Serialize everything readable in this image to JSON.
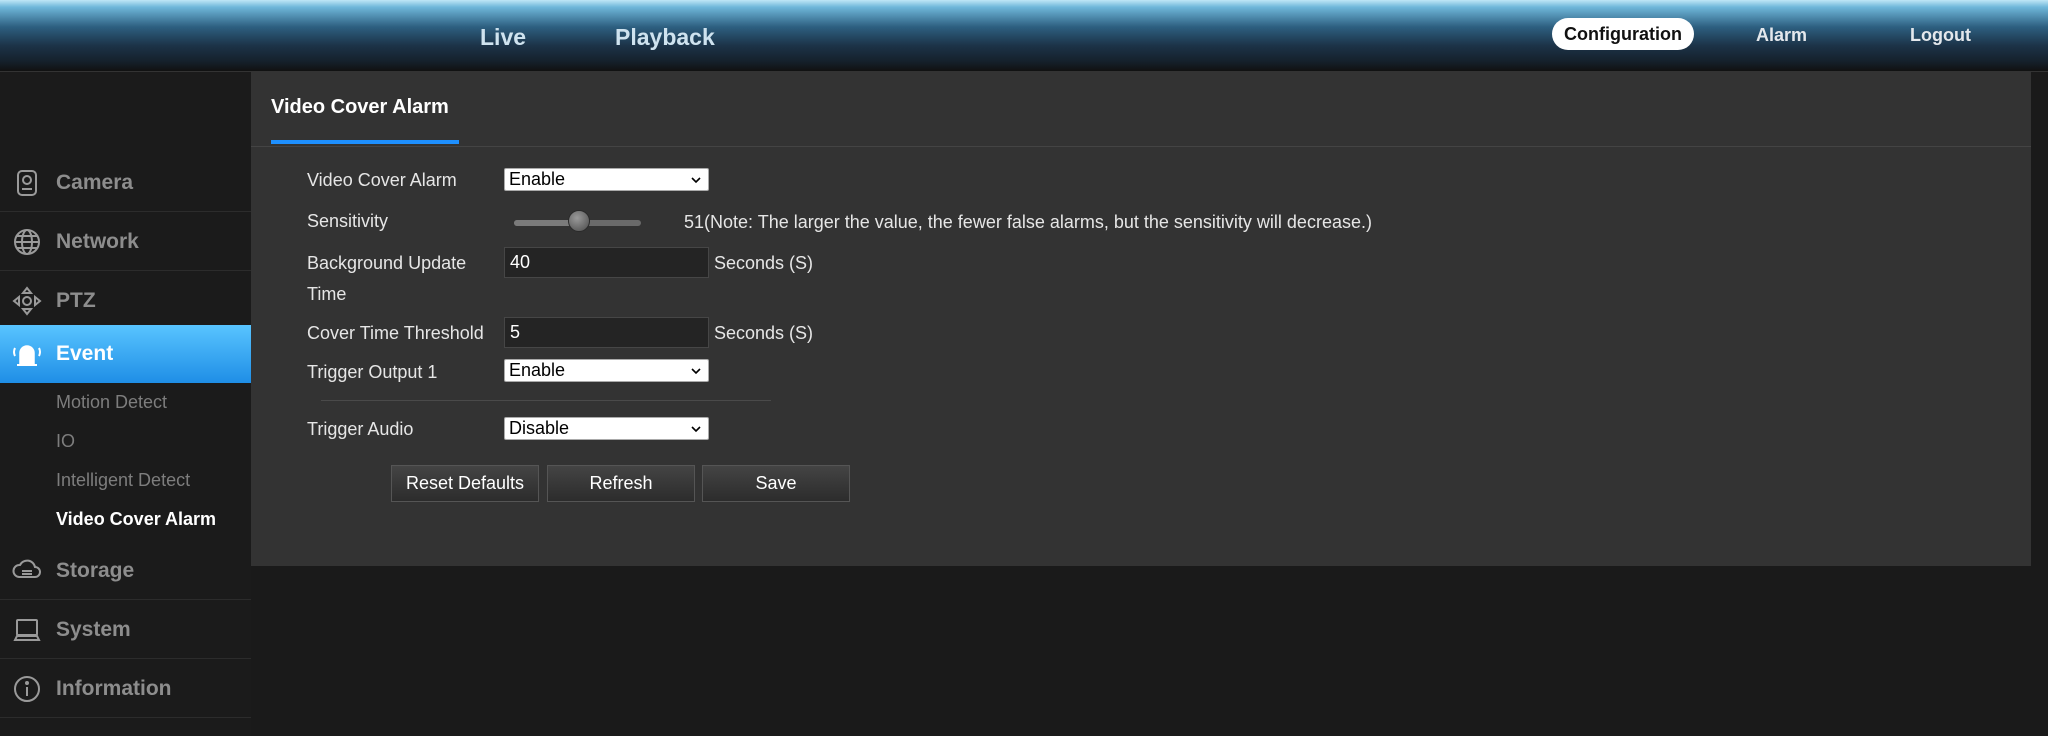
{
  "topnav": {
    "live": "Live",
    "playback": "Playback",
    "configuration": "Configuration",
    "alarm": "Alarm",
    "logout": "Logout"
  },
  "sidebar": {
    "items": [
      {
        "label": "Camera",
        "icon": "camera-icon"
      },
      {
        "label": "Network",
        "icon": "globe-icon"
      },
      {
        "label": "PTZ",
        "icon": "ptz-arrows-icon"
      },
      {
        "label": "Event",
        "icon": "alarm-bell-icon"
      },
      {
        "label": "Storage",
        "icon": "cloud-storage-icon"
      },
      {
        "label": "System",
        "icon": "computer-icon"
      },
      {
        "label": "Information",
        "icon": "info-icon"
      }
    ],
    "event_subitems": [
      "Motion Detect",
      "IO",
      "Intelligent Detect",
      "Video Cover Alarm"
    ]
  },
  "panel": {
    "tab_title": "Video Cover Alarm",
    "fields": {
      "video_cover_alarm": {
        "label": "Video Cover Alarm",
        "value": "Enable"
      },
      "sensitivity": {
        "label": "Sensitivity",
        "value": "51",
        "min": 0,
        "max": 100,
        "note": "(Note: The larger the value, the fewer false alarms, but the sensitivity will decrease.)"
      },
      "background_update": {
        "label_line1": "Background Update",
        "label_line2": "Time",
        "value": "40",
        "unit": "Seconds (S)"
      },
      "cover_time_threshold": {
        "label": "Cover Time Threshold",
        "value": "5",
        "unit": "Seconds (S)"
      },
      "trigger_output_1": {
        "label": "Trigger Output 1",
        "value": "Enable"
      },
      "trigger_audio": {
        "label": "Trigger Audio",
        "value": "Disable"
      }
    },
    "buttons": {
      "reset": "Reset Defaults",
      "refresh": "Refresh",
      "save": "Save"
    }
  },
  "colors": {
    "accent": "#1e90ff",
    "active_sidebar": "#2b99ec",
    "panel_bg": "#333333"
  }
}
